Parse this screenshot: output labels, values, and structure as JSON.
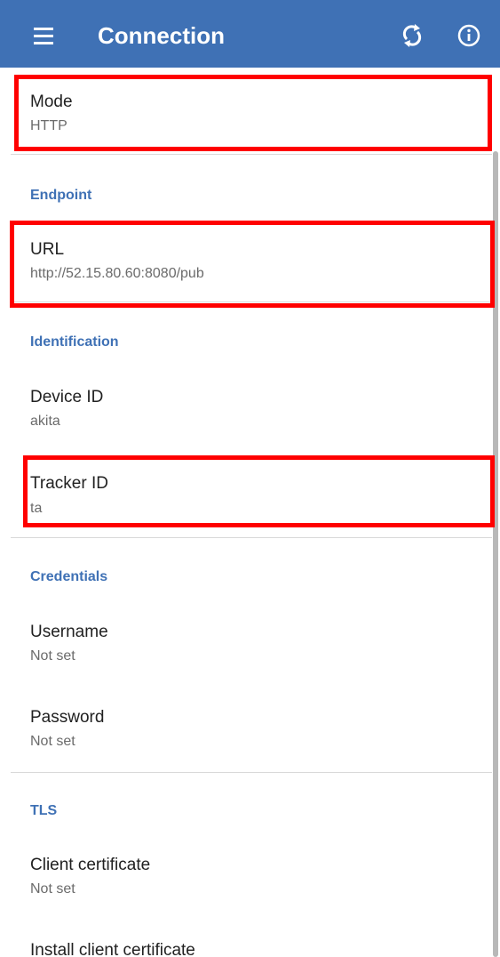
{
  "toolbar": {
    "menu_icon": "menu-icon",
    "title": "Connection",
    "sync_icon": "sync-icon",
    "info_icon": "info-icon",
    "background": "#3f71b5"
  },
  "accent_color": "#3f71b5",
  "highlight_color": "#ff0000",
  "preferences": {
    "mode": {
      "title": "Mode",
      "summary": "HTTP"
    },
    "endpoint_category": "Endpoint",
    "url": {
      "title": "URL",
      "summary": "http://52.15.80.60:8080/pub"
    },
    "identification_category": "Identification",
    "device_id": {
      "title": "Device ID",
      "summary": "akita"
    },
    "tracker_id": {
      "title": "Tracker ID",
      "summary": "ta"
    },
    "credentials_category": "Credentials",
    "username": {
      "title": "Username",
      "summary": "Not set"
    },
    "password": {
      "title": "Password",
      "summary": "Not set"
    },
    "tls_category": "TLS",
    "client_certificate": {
      "title": "Client certificate",
      "summary": "Not set"
    },
    "install_client_certificate": {
      "title": "Install client certificate"
    }
  }
}
